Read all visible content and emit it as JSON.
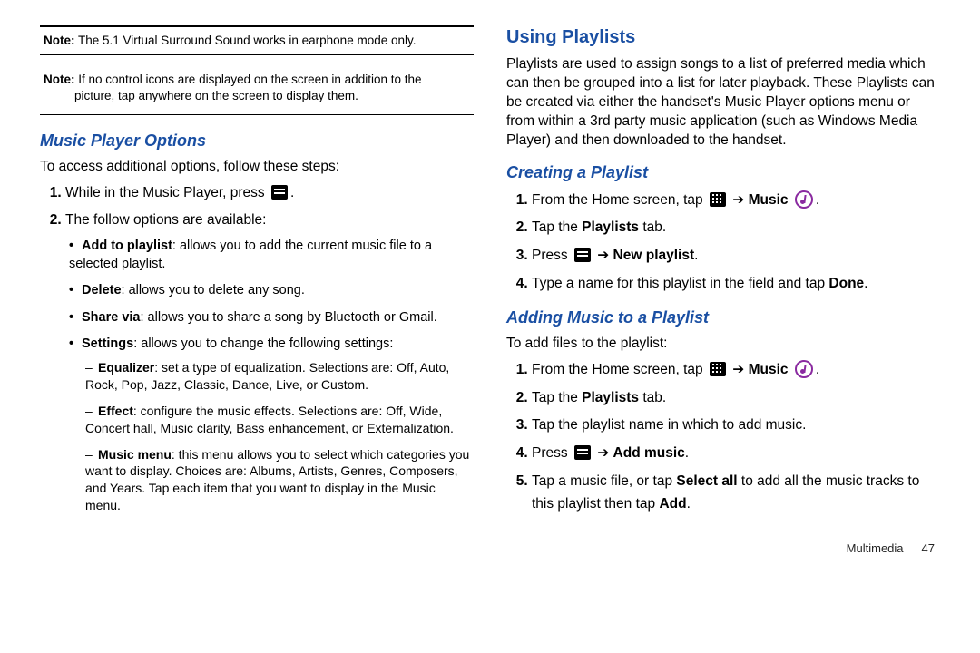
{
  "left": {
    "note1_label": "Note:",
    "note1_text": " The 5.1 Virtual Surround Sound works in earphone mode only.",
    "note2_label": "Note:",
    "note2_line1": " If no control icons are displayed on the screen in addition to the",
    "note2_line2": "picture, tap anywhere on the screen to display them.",
    "h_music_options": "Music Player Options",
    "intro": "To access additional options, follow these steps:",
    "step1_a": "While in the Music Player, press ",
    "step1_b": ".",
    "step2": "The follow options are available:",
    "b_addpl_label": "Add to playlist",
    "b_addpl_text": ": allows you to add the current music file to a selected playlist.",
    "b_delete_label": "Delete",
    "b_delete_text": ": allows you to delete any song.",
    "b_share_label": "Share via",
    "b_share_text": ": allows you to share a song by Bluetooth or Gmail.",
    "b_settings_label": "Settings",
    "b_settings_text": ": allows you to change the following settings:",
    "d_eq_label": "Equalizer",
    "d_eq_text": ": set a type of equalization. Selections are: Off, Auto, Rock, Pop, Jazz, Classic, Dance, Live, or Custom.",
    "d_effect_label": "Effect",
    "d_effect_text": ": configure the music effects. Selections are: Off, Wide, Concert hall, Music clarity, Bass enhancement, or Externalization.",
    "d_menu_label": "Music menu",
    "d_menu_text": ": this menu allows you to select which categories you want to display. Choices are: Albums, Artists, Genres, Composers, and Years. Tap each item that you want to display in the Music menu."
  },
  "right": {
    "h_using": "Using Playlists",
    "p_using": "Playlists are used to assign songs to a list of preferred media which can then be grouped into a list for later playback. These Playlists can be created via either the handset's Music Player options menu or from within a 3rd party music application (such as Windows Media Player) and then downloaded to the handset.",
    "h_creating": "Creating a Playlist",
    "c1_a": "From the Home screen, tap ",
    "c1_arrow": " ➔ ",
    "c1_music": "Music",
    "c1_dot": ".",
    "c2_a": "Tap the ",
    "c2_b": "Playlists",
    "c2_c": " tab.",
    "c3_a": "Press ",
    "c3_arrow": " ➔ ",
    "c3_b": "New playlist",
    "c3_c": ".",
    "c4_a": "Type a name for this playlist in the field and tap ",
    "c4_b": "Done",
    "c4_c": ".",
    "h_adding": "Adding Music to a Playlist",
    "p_adding": "To add files to the playlist:",
    "a1_a": "From the Home screen, tap ",
    "a1_arrow": " ➔ ",
    "a1_music": "Music",
    "a1_dot": ".",
    "a2_a": "Tap the ",
    "a2_b": "Playlists",
    "a2_c": " tab.",
    "a3": "Tap the playlist name in which to add music.",
    "a4_a": "Press ",
    "a4_arrow": " ➔ ",
    "a4_b": "Add music",
    "a4_c": ".",
    "a5_a": "Tap a music file, or tap ",
    "a5_b": "Select all",
    "a5_c": " to add all the music tracks to this playlist then tap ",
    "a5_d": "Add",
    "a5_e": ".",
    "footer_label": "Multimedia",
    "footer_page": "47"
  }
}
